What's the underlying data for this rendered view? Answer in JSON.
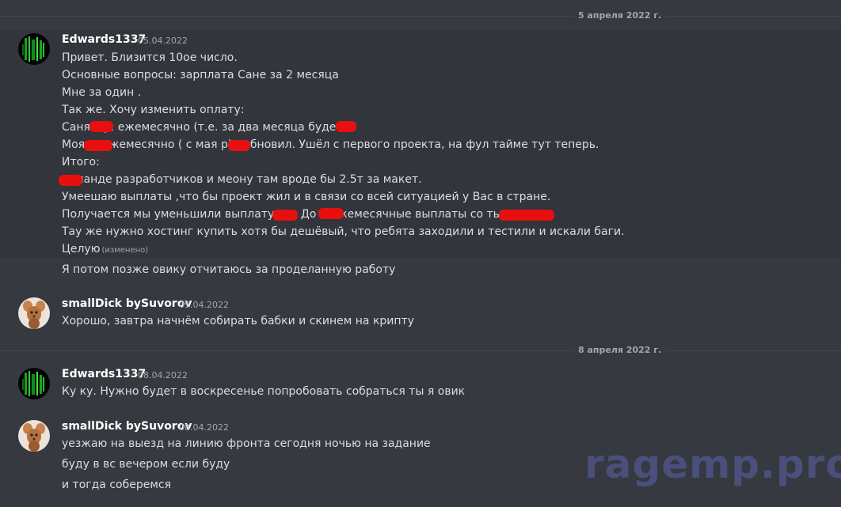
{
  "dividers": [
    "5 апреля 2022 г.",
    "8 апреля 2022 г."
  ],
  "messages": [
    {
      "author": "Edwards1337",
      "time": "05.04.2022",
      "lines": [
        "Привет. Близится 10ое число.",
        "Основные вопросы: зарплата Сане за 2 месяца",
        "Мне за один .",
        "Так же. Хочу изменить оплату:",
        "Саня       т.р. ежемесячно (т.е. за два месяца будет      )",
        "Моя        р. ежемесячно ( с мая        р) - обновил. Ушёл с первого проекта, на фул тайме тут теперь.",
        "Итого:",
        "        команде разработчиков и меону там вроде бы 2.5т за макет.",
        "Умеешаю выплаты ,что бы проект жил и в связи со всей ситуацией у Вас в стране.",
        "Получается мы уменьшили выплату с        т. До        и ежемесячные выплаты со                  тысяч.",
        "Тау же нужно хостинг купить хотя бы дешёвый, что ребята заходили и тестили и искали баги.",
        "Целую"
      ],
      "edited": "(изменено)"
    },
    {
      "author": "",
      "time": "",
      "lines": [
        "Я потом позже овику отчитаюсь за проделанную работу"
      ]
    },
    {
      "author": "smallDick bySuvorov",
      "time": "05.04.2022",
      "lines": [
        "Хорошо, завтра начнём собирать бабки и скинем на крипту"
      ]
    },
    {
      "author": "Edwards1337",
      "time": "08.04.2022",
      "lines": [
        "Ку ку. Нужно будет в воскресенье попробовать собраться ты я овик"
      ]
    },
    {
      "author": "smallDick bySuvorov",
      "time": "08.04.2022",
      "lines": [
        "уезжаю на выезд на линию фронта сегодня ночью на задание",
        "буду в вс вечером если буду",
        "и тогда соберемся"
      ]
    }
  ],
  "watermark": "ragemp.pro",
  "colors": {
    "background": "#36393f",
    "redaction": "#e8100e",
    "watermark": "#4d5382"
  },
  "icons": {
    "avatar_edwards": "green-glitch-avatar",
    "avatar_suvorov": "cartoon-mouse-avatar"
  }
}
